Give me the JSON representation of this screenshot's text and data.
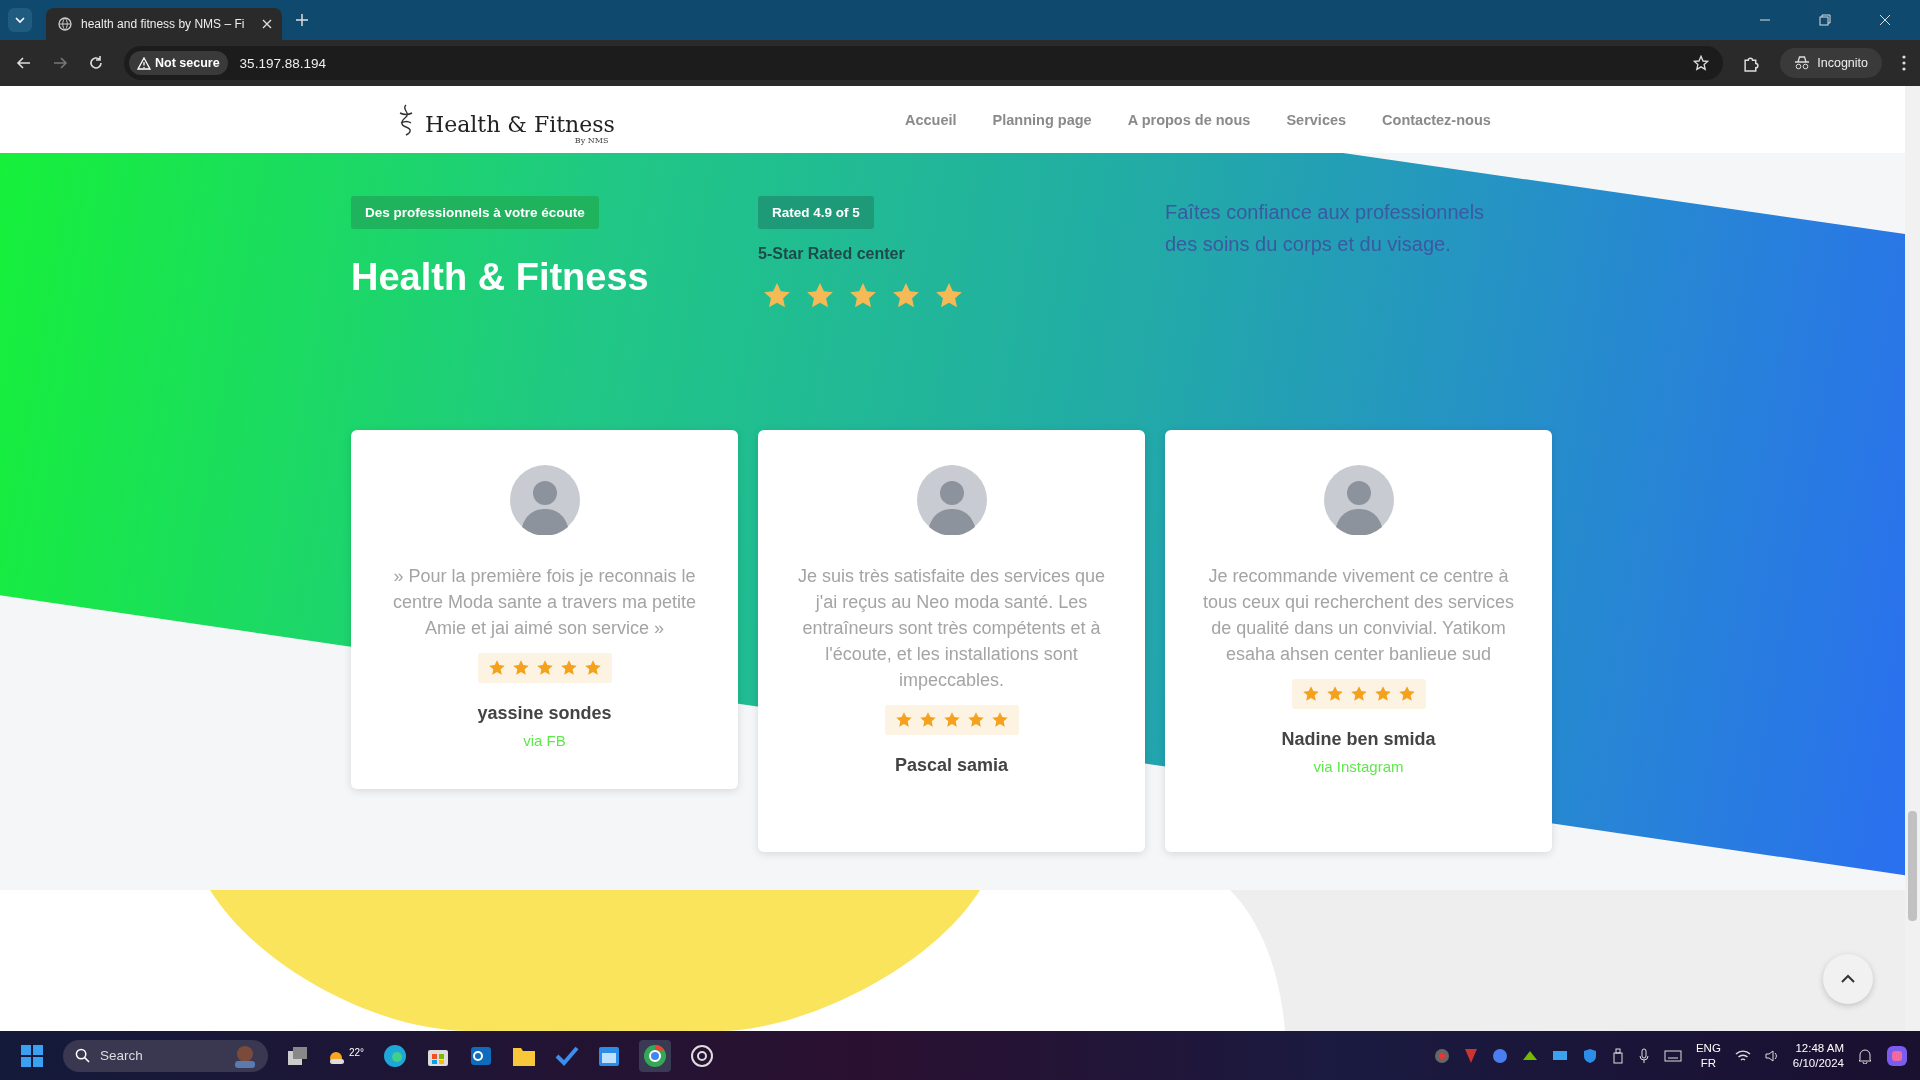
{
  "browser": {
    "tab_title": "health and fitness by NMS – Fi",
    "security": "Not secure",
    "url": "35.197.88.194",
    "profile": "Incognito"
  },
  "nav": {
    "logo_text": "Health & Fitness",
    "logo_sub": "By NMS",
    "items": [
      {
        "label": "Accueil"
      },
      {
        "label": "Planning page"
      },
      {
        "label": "A propos de nous"
      },
      {
        "label": "Services"
      },
      {
        "label": "Contactez-nous"
      }
    ]
  },
  "hero": {
    "badge": "Des professionnels à votre écoute",
    "title": "Health & Fitness",
    "rating_badge": "Rated 4.9 of 5",
    "rating_label": "5-Star Rated center",
    "stars": 5,
    "tagline": "Faîtes confiance aux professionnels des soins du corps et du visage."
  },
  "testimonials": [
    {
      "quote": "» Pour la première fois je reconnais le centre Moda sante a travers ma petite Amie et jai aimé son service »",
      "stars": 5,
      "name": "yassine sondes",
      "source": "via FB"
    },
    {
      "quote": "Je suis très satisfaite des services que j'ai reçus au Neo moda santé. Les entraîneurs sont très compétents et à l'écoute, et les installations sont impeccables.",
      "stars": 5,
      "name": "Pascal samia"
    },
    {
      "quote": "Je recommande vivement ce centre à tous ceux qui recherchent des services de qualité dans un convivial. Yatikom esaha ahsen center banlieue sud",
      "stars": 5,
      "name": "Nadine ben smida",
      "source": "via Instagram"
    }
  ],
  "taskbar": {
    "search_placeholder": "Search",
    "weather": "22°",
    "language": "ENG",
    "layout": "FR",
    "time": "12:48 AM",
    "date": "6/10/2024"
  }
}
